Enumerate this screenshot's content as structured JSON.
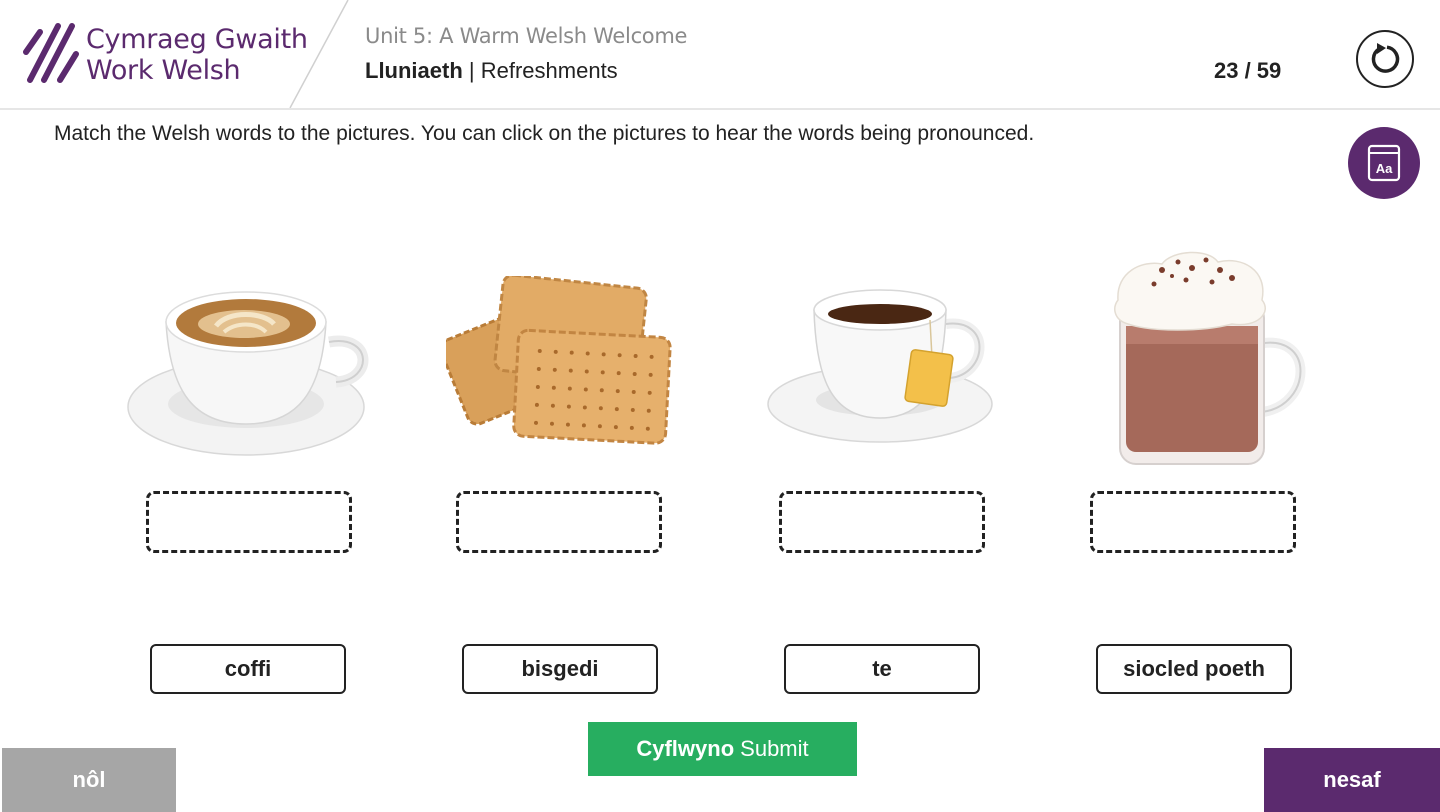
{
  "brand": {
    "line1": "Cymraeg Gwaith",
    "line2": "Work Welsh",
    "color": "#5b2a6e"
  },
  "header": {
    "unit_title": "Unit 5: A Warm Welsh Welcome",
    "lesson_welsh": "Lluniaeth",
    "lesson_separator": " | ",
    "lesson_english": "Refreshments",
    "page_counter": "23 / 59",
    "reset_icon": "reset-icon"
  },
  "instruction": "Match the Welsh words to the pictures. You can click on the pictures to hear the words being pronounced.",
  "font_button_label": "Aa",
  "pictures": [
    {
      "icon": "coffee-cup-image"
    },
    {
      "icon": "biscuits-image"
    },
    {
      "icon": "tea-cup-image"
    },
    {
      "icon": "hot-chocolate-image"
    }
  ],
  "words": [
    "coffi",
    "bisgedi",
    "te",
    "siocled poeth"
  ],
  "submit": {
    "welsh": "Cyflwyno",
    "english": "Submit",
    "color": "#27ae60"
  },
  "nav": {
    "back": "nôl",
    "next": "nesaf",
    "back_color": "#a6a6a6",
    "next_color": "#5b2a6e"
  }
}
